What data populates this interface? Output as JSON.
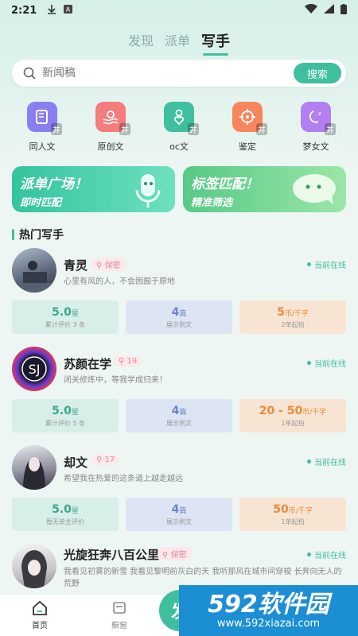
{
  "status": {
    "time": "2:21"
  },
  "tabs": [
    {
      "label": "发现"
    },
    {
      "label": "派单"
    },
    {
      "label": "写手"
    }
  ],
  "search": {
    "placeholder": "新闻稿",
    "button": "搜索"
  },
  "categories": [
    {
      "label": "同人文",
      "icon": "book-icon",
      "color": "#8a7ff0"
    },
    {
      "label": "原创文",
      "icon": "bulb-icon",
      "color": "#f47c7c"
    },
    {
      "label": "oc文",
      "icon": "person-heart-icon",
      "color": "#3fbf9f"
    },
    {
      "label": "鉴定",
      "icon": "target-icon",
      "color": "#f7865f"
    },
    {
      "label": "梦女文",
      "icon": "moon-icon",
      "color": "#b37ff0"
    }
  ],
  "banners": [
    {
      "line1": "派单广场！",
      "line2": "即时匹配"
    },
    {
      "line1": "标签匹配！",
      "line2": "精准筛选"
    }
  ],
  "section_title": "热门写手",
  "writers": [
    {
      "name": "青灵",
      "badge": "保密",
      "online": "当前在线",
      "bio": "心里有风的人，不会困囿于原地",
      "stats": [
        {
          "value": "5.0",
          "unit": "星",
          "sub": "累计评价 3 条"
        },
        {
          "value": "4",
          "unit": "篇",
          "sub": "展示例文"
        },
        {
          "value": "5",
          "unit": "币/千字",
          "sub": "2单起拍"
        }
      ]
    },
    {
      "name": "苏颜在学",
      "badge": "19",
      "online": "当前在线",
      "bio": "闭关修炼中，等我学成归来！",
      "stats": [
        {
          "value": "5.0",
          "unit": "星",
          "sub": "累计评价 5 条"
        },
        {
          "value": "4",
          "unit": "篇",
          "sub": "展示例文"
        },
        {
          "value": "20 - 50",
          "unit": "币/千字",
          "sub": "1单起拍"
        }
      ]
    },
    {
      "name": "却文",
      "badge": "17",
      "online": "当前在线",
      "bio": "希望我在热爱的这条道上越走越远",
      "stats": [
        {
          "value": "5.0",
          "unit": "星",
          "sub": "暂无单主评价"
        },
        {
          "value": "4",
          "unit": "篇",
          "sub": "展示例文"
        },
        {
          "value": "50",
          "unit": "币/千字",
          "sub": "1单起拍"
        }
      ]
    },
    {
      "name": "光旋狂奔八百公里",
      "badge": "保密",
      "online": "当前在线",
      "bio": "我看见初雾的新雪 我看见黎明前灰白的天 我听那风在城市间穿梭 长奔向无人的荒野"
    }
  ],
  "bottom_nav": [
    {
      "label": "首页",
      "icon": "home-icon"
    },
    {
      "label": "橱窗",
      "icon": "inbox-icon"
    }
  ],
  "fab": {
    "label": "发"
  },
  "watermark": {
    "text": "592软件园",
    "url": "www.592xiazai.com"
  }
}
